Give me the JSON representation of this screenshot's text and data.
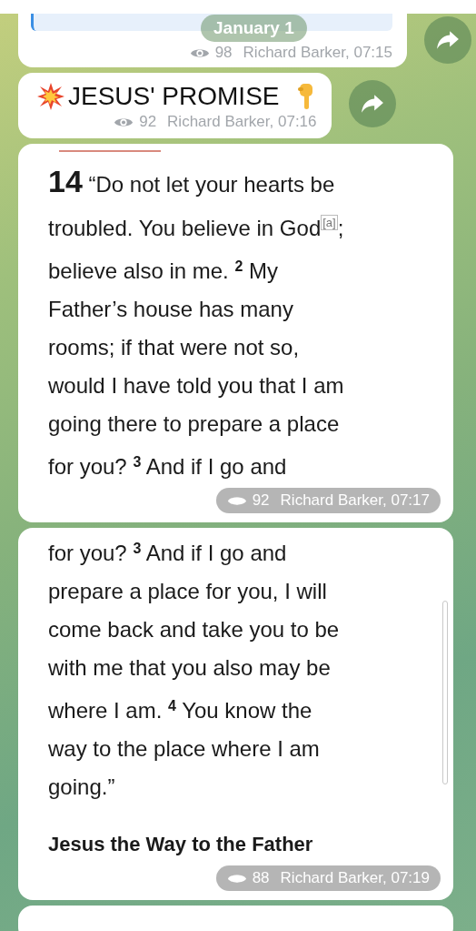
{
  "date_pill": "January 1",
  "messages": [
    {
      "kind": "quote",
      "views": "98",
      "signature": "Richard Barker, 07:15",
      "forward": true
    },
    {
      "kind": "title",
      "text": "JESUS' PROMISE",
      "views": "92",
      "signature": "Richard Barker, 07:16",
      "forward": true
    },
    {
      "kind": "image_text",
      "accent": true,
      "views": "92",
      "signature": "Richard Barker, 07:17",
      "lines": [
        [
          {
            "kind": "chapter",
            "text": "14"
          },
          {
            "kind": "text",
            "text": " “Do not let your hearts be"
          }
        ],
        [
          {
            "kind": "text",
            "text": "troubled. You believe in God"
          },
          {
            "kind": "footnote",
            "text": "[a]"
          },
          {
            "kind": "text",
            "text": ";"
          }
        ],
        [
          {
            "kind": "text",
            "text": "believe also in me. "
          },
          {
            "kind": "verse",
            "text": "2"
          },
          {
            "kind": "text",
            "text": " My"
          }
        ],
        [
          {
            "kind": "text",
            "text": "Father’s house has many"
          }
        ],
        [
          {
            "kind": "text",
            "text": "rooms; if that were not so,"
          }
        ],
        [
          {
            "kind": "text",
            "text": "would I have told you that I am"
          }
        ],
        [
          {
            "kind": "text",
            "text": "going there to prepare a place"
          }
        ],
        [
          {
            "kind": "text",
            "text": "for you? "
          },
          {
            "kind": "verse",
            "text": "3"
          },
          {
            "kind": "text",
            "text": " And if I go and"
          }
        ]
      ]
    },
    {
      "kind": "image_text",
      "views": "88",
      "signature": "Richard Barker, 07:19",
      "lines": [
        [
          {
            "kind": "text",
            "text": "for you? "
          },
          {
            "kind": "verse",
            "text": "3"
          },
          {
            "kind": "text",
            "text": " And if I go and"
          }
        ],
        [
          {
            "kind": "text",
            "text": "prepare a place for you, I will"
          }
        ],
        [
          {
            "kind": "text",
            "text": "come back and take you to be"
          }
        ],
        [
          {
            "kind": "text",
            "text": "with me that you also may be"
          }
        ],
        [
          {
            "kind": "text",
            "text": "where I am. "
          },
          {
            "kind": "verse",
            "text": "4"
          },
          {
            "kind": "text",
            "text": " You know the"
          }
        ],
        [
          {
            "kind": "text",
            "text": "way to the place where I am"
          }
        ],
        [
          {
            "kind": "text",
            "text": "going.”"
          }
        ],
        [
          {
            "kind": "heading",
            "text": "Jesus the Way to the Father"
          }
        ]
      ]
    }
  ]
}
